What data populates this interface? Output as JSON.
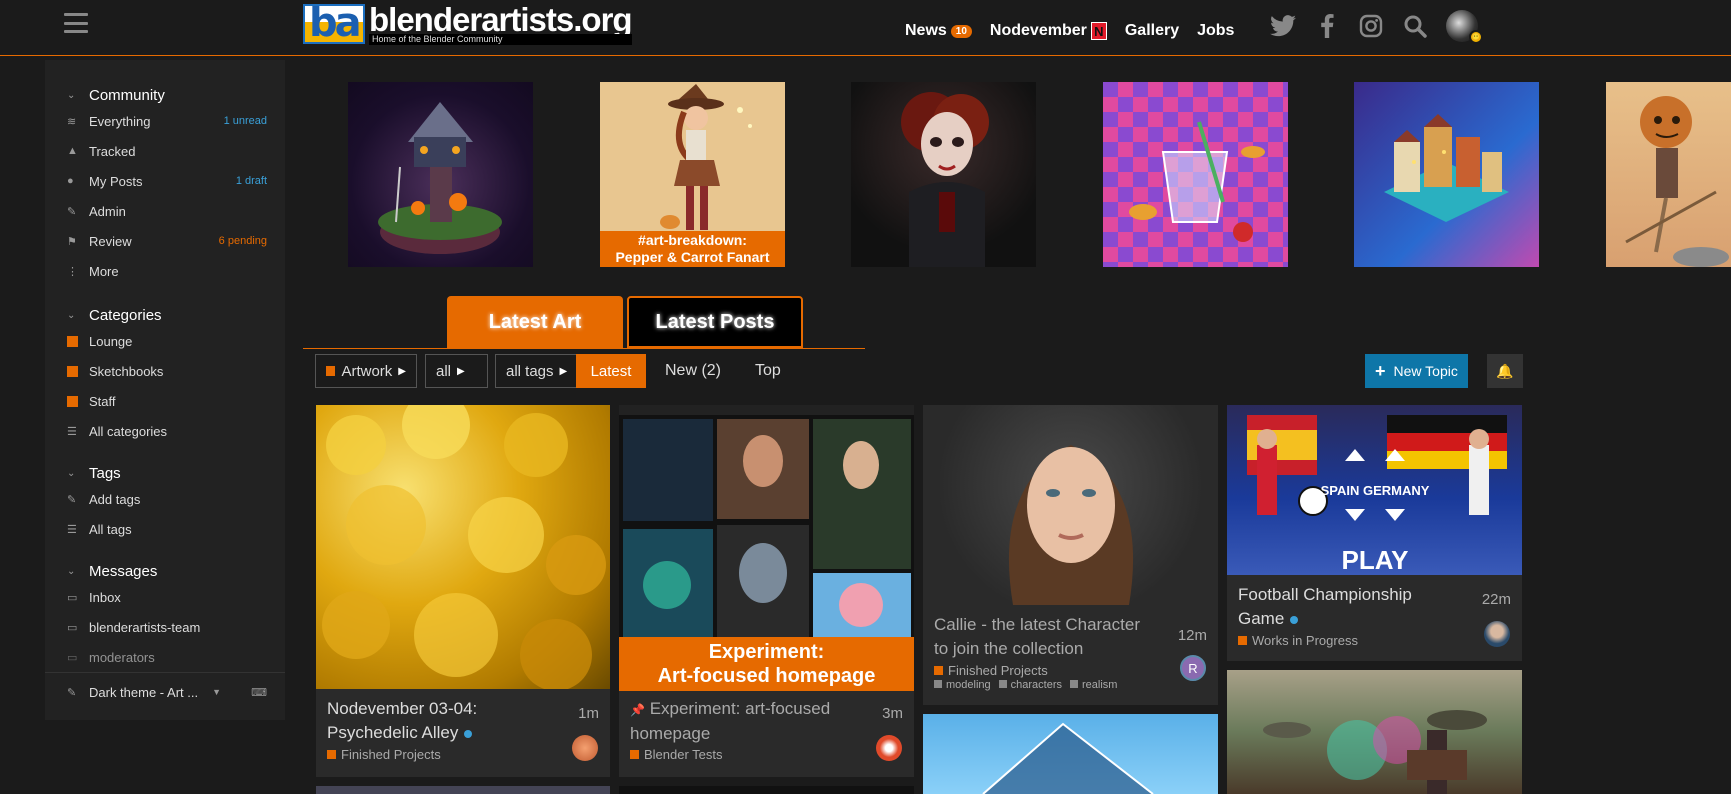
{
  "header": {
    "logo_mark": "ba",
    "logo_title": "blenderartists.org",
    "logo_subtitle": "Home of the Blender Community",
    "nav": [
      {
        "label": "News",
        "badge": "10"
      },
      {
        "label": "Nodevember",
        "badge": "N"
      },
      {
        "label": "Gallery"
      },
      {
        "label": "Jobs"
      }
    ],
    "icons": [
      "twitter-icon",
      "facebook-icon",
      "instagram-icon",
      "search-icon"
    ],
    "avatar_status": "😶"
  },
  "sidebar": {
    "community": {
      "title": "Community",
      "items": [
        {
          "label": "Everything",
          "meta": "1 unread",
          "meta_color": "blue",
          "icon": "layers-icon",
          "glyph": "≋"
        },
        {
          "label": "Tracked",
          "meta": "",
          "icon": "bell-icon",
          "glyph": "🔔"
        },
        {
          "label": "My Posts",
          "meta": "1 draft",
          "meta_color": "blue",
          "icon": "user-icon",
          "glyph": "👤"
        },
        {
          "label": "Admin",
          "meta": "",
          "icon": "wrench-icon",
          "glyph": "🔧"
        },
        {
          "label": "Review",
          "meta": "6 pending",
          "meta_color": "orange",
          "icon": "flag-icon",
          "glyph": "⚑"
        },
        {
          "label": "More",
          "meta": "",
          "icon": "more-vertical-icon",
          "glyph": "⋮"
        }
      ]
    },
    "categories": {
      "title": "Categories",
      "items": [
        {
          "label": "Lounge",
          "lock": true
        },
        {
          "label": "Sketchbooks",
          "lock": false
        },
        {
          "label": "Staff",
          "lock": true
        },
        {
          "label": "All categories",
          "icon": "list-icon"
        }
      ]
    },
    "tags": {
      "title": "Tags",
      "items": [
        {
          "label": "Add tags",
          "icon": "pencil-icon"
        },
        {
          "label": "All tags",
          "icon": "list-icon"
        }
      ]
    },
    "messages": {
      "title": "Messages",
      "items": [
        {
          "label": "Inbox"
        },
        {
          "label": "blenderartists-team"
        },
        {
          "label": "moderators"
        }
      ]
    },
    "footer": {
      "label": "Dark theme - Art ..."
    }
  },
  "carousel": {
    "captions": [
      "#art-breakdown:",
      "Pepper & Carrot Fanart"
    ]
  },
  "tabs": {
    "active": "Latest Art",
    "inactive": "Latest Posts"
  },
  "filters": {
    "category": "Artwork",
    "sub": "all",
    "tags": "all tags",
    "latest": "Latest",
    "new": "New (2)",
    "top": "Top",
    "new_topic": "New Topic"
  },
  "cards": [
    {
      "title1": "Nodevember 03-04:",
      "title2": "Psychedelic Alley",
      "age": "1m",
      "category": "Finished Projects",
      "unread": true
    },
    {
      "title1": "Experiment: art-focused",
      "title2": "homepage",
      "age": "3m",
      "category": "Blender Tests",
      "overlay1": "Experiment:",
      "overlay2": "Art-focused homepage"
    },
    {
      "title1": "Callie - the latest Character",
      "title2": "to join the collection",
      "age": "12m",
      "category": "Finished Projects",
      "tags": [
        "modeling",
        "characters",
        "realism"
      ],
      "avatar_letter": "R"
    },
    {
      "title1": "Football Championship",
      "title2": "Game",
      "age": "22m",
      "category": "Works in Progress",
      "unread": true,
      "game_left": "SPAIN",
      "game_right": "GERMANY",
      "game_play": "PLAY"
    }
  ],
  "colors": {
    "accent": "#e66a00",
    "blue": "#3aa0d8",
    "bg": "#1b1b1b",
    "panel": "#222222"
  }
}
